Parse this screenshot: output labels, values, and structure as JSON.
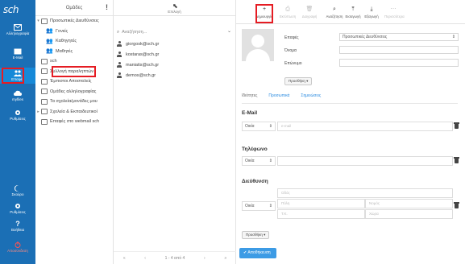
{
  "app": {
    "logo": "sch"
  },
  "sidebar": {
    "items": [
      {
        "label": "Αλληλογραφία",
        "icon": "mail-icon"
      },
      {
        "label": "E-Mail",
        "icon": "envelope-icon"
      },
      {
        "label": "Επαφές",
        "icon": "contacts-icon"
      },
      {
        "label": "myfiles",
        "icon": "cloud-icon"
      },
      {
        "label": "Ρυθμίσεις",
        "icon": "gear-icon"
      },
      {
        "label": "Σκούρο",
        "icon": "moon-icon"
      },
      {
        "label": "Ρυθμίσεις",
        "icon": "settings-icon"
      },
      {
        "label": "Βοήθεια",
        "icon": "help-icon"
      },
      {
        "label": "Αποσύνδεση",
        "icon": "logout-icon"
      }
    ]
  },
  "folders": {
    "title": "Ομάδες",
    "items": [
      {
        "label": "Προσωπικές Διευθύνσεις",
        "type": "folder",
        "toggle": "▾"
      },
      {
        "label": "Γονείς",
        "type": "group"
      },
      {
        "label": "Καθηγητές",
        "type": "group"
      },
      {
        "label": "Μαθητές",
        "type": "group"
      },
      {
        "label": "sch",
        "type": "folder"
      },
      {
        "label": "Συλλογή παραληπτών",
        "type": "folder"
      },
      {
        "label": "Έμπιστοι Αποστολείς",
        "type": "folder"
      },
      {
        "label": "Ομάδες αλληλογραφίας",
        "type": "folder"
      },
      {
        "label": "Τα σχολεία/μονάδες μου",
        "type": "folder"
      },
      {
        "label": "Σχολεία & Εκπαιδευτικοί",
        "type": "folder",
        "toggle": "▸"
      },
      {
        "label": "Επαφές στο webmail sch",
        "type": "folder"
      }
    ]
  },
  "list": {
    "select_label": "Επιλογή",
    "search_placeholder": "Αναζήτηση...",
    "contacts": [
      "giorgosk@sch.gr",
      "kostaras@sch.gr",
      "maniatis@sch.gr",
      "demos@sch.gr"
    ],
    "pager": {
      "first": "«",
      "prev": "‹",
      "info": "1 - 4 από 4",
      "next": "›",
      "last": "»"
    }
  },
  "toolbar": {
    "buttons": [
      {
        "label": "Δημιουργία",
        "icon": "+",
        "enabled": true
      },
      {
        "label": "Εκτύπωση",
        "icon": "⎙",
        "enabled": false
      },
      {
        "label": "Διαγραφή",
        "icon": "🗑",
        "enabled": false
      },
      {
        "label": "Αναζήτηση",
        "icon": "⌕",
        "enabled": true
      },
      {
        "label": "Εισαγωγή",
        "icon": "⤒",
        "enabled": true
      },
      {
        "label": "Εξαγωγή",
        "icon": "⤓",
        "enabled": true
      },
      {
        "label": "Περισσότερα",
        "icon": "⋯",
        "enabled": false
      }
    ]
  },
  "form": {
    "group_label": "Επαφές",
    "group_value": "Προσωπικές Διευθύνσεις",
    "name_label": "Όνομα",
    "surname_label": "Επώνυμο",
    "add_button": "Προσθήκη ▾",
    "tabs": [
      "Ιδιότητες",
      "Προσωπικά",
      "Σημειώσεις"
    ],
    "email": {
      "title": "E-Mail",
      "type": "Οικία",
      "placeholder": "e-mail"
    },
    "phone": {
      "title": "Τηλέφωνο",
      "type": "Οικία",
      "placeholder": ""
    },
    "address": {
      "title": "Διεύθυνση",
      "type": "Οικία",
      "street": "Οδός",
      "city": "Πόλη",
      "region": "Νομός",
      "zip": "Τ.Κ.",
      "country": "Χώρα"
    },
    "add_field_button": "Προσθήκη ▾",
    "save_button": "Αποθήκευση"
  },
  "colors": {
    "sidebar": "#1b6fb5",
    "accent": "#3c9be5",
    "highlight": "#e51c23"
  }
}
